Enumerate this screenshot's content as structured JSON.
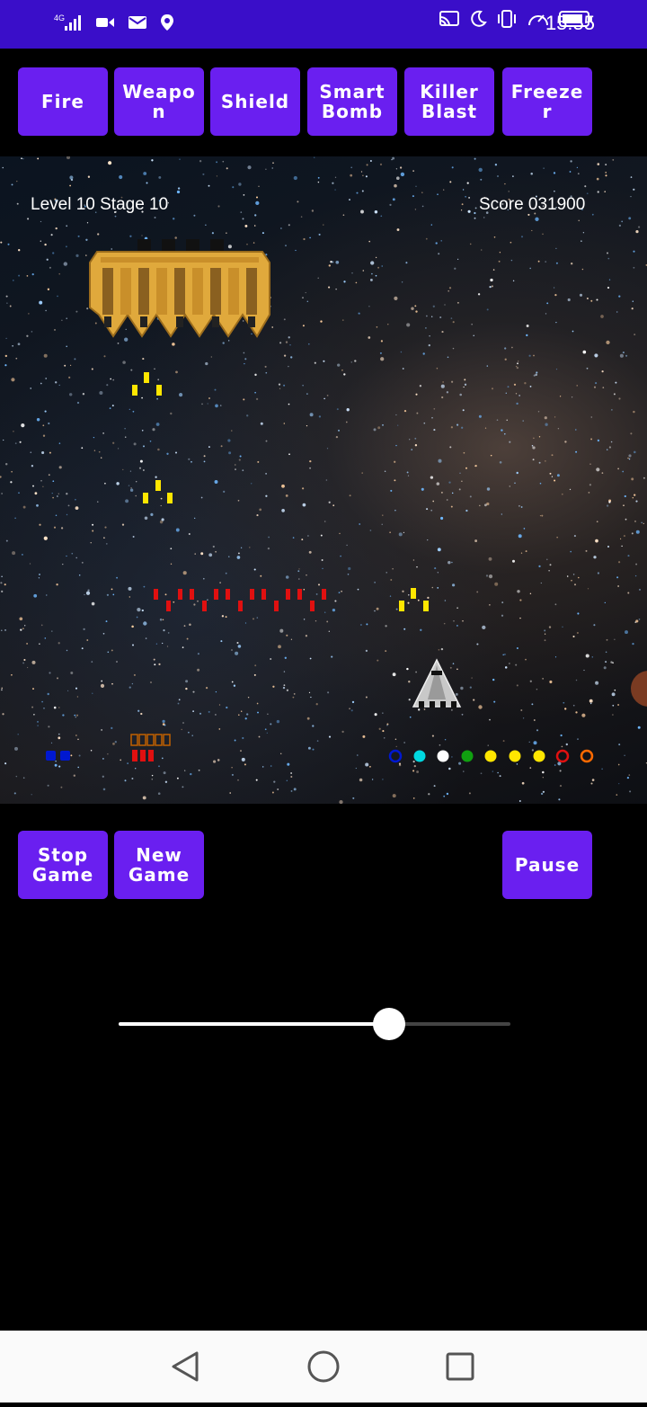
{
  "status_bar": {
    "time": "15:55",
    "network_label": "4G",
    "left_icons": [
      "signal-icon",
      "video-icon",
      "mail-icon",
      "location-icon"
    ],
    "right_icons": [
      "cast-icon",
      "moon-icon",
      "vibrate-icon",
      "speed-icon",
      "battery-icon"
    ],
    "background": "#3a0ec9"
  },
  "top_buttons": [
    {
      "name": "fire-button",
      "label": "Fire"
    },
    {
      "name": "weapon-button",
      "label": "Weapo\nn"
    },
    {
      "name": "shield-button",
      "label": "Shield"
    },
    {
      "name": "smart-bomb-button",
      "label": "Smart\nBomb"
    },
    {
      "name": "killer-blast-button",
      "label": "Killer\nBlast"
    },
    {
      "name": "freezer-button",
      "label": "Freeze\nr"
    }
  ],
  "hud": {
    "level_stage": "Level 10  Stage 10",
    "score": "Score 031900"
  },
  "bottom_buttons": {
    "stop_label": "Stop\nGame",
    "new_label": "New\nGame",
    "pause_label": "Pause"
  },
  "slider": {
    "value": 0.69
  },
  "colors": {
    "button": "#6a1ff0",
    "boss": "#e0a93c",
    "enemy_bullet_yellow": "#ffe600",
    "enemy_bullet_red": "#e01010"
  },
  "weapon_indicators": [
    "#0018d0",
    "#00d8e0",
    "#ffffff",
    "#10a010",
    "#ffe600",
    "#ffe600",
    "#ffe600",
    "#e01010",
    "#ff6a00"
  ],
  "nav_icons": [
    "back-icon",
    "home-icon",
    "recents-icon"
  ]
}
